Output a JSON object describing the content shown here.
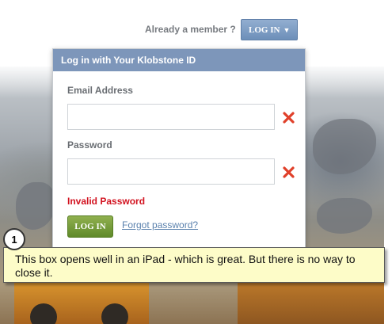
{
  "header": {
    "already_member": "Already a member ?",
    "login_button": "LOG IN",
    "login_caret_icon": "caret-down-icon"
  },
  "login_panel": {
    "title": "Log in with Your Klobstone ID",
    "email_label": "Email Address",
    "email_value": "",
    "password_label": "Password",
    "password_value": "",
    "error_icon": "red-x-icon",
    "error_color": "#d2121f",
    "error_message": "Invalid Password",
    "submit_label": "LOG IN",
    "forgot_link": "Forgot password?"
  },
  "annotation": {
    "number": "1",
    "text": "This box opens well in an iPad - which is great. But there is no way to close it."
  },
  "colors": {
    "header_button": "#6d8fb9",
    "panel_header": "#7d96ba",
    "submit_button": "#6f9634",
    "link": "#5a81ad",
    "callout_background": "#fdfcc8"
  }
}
